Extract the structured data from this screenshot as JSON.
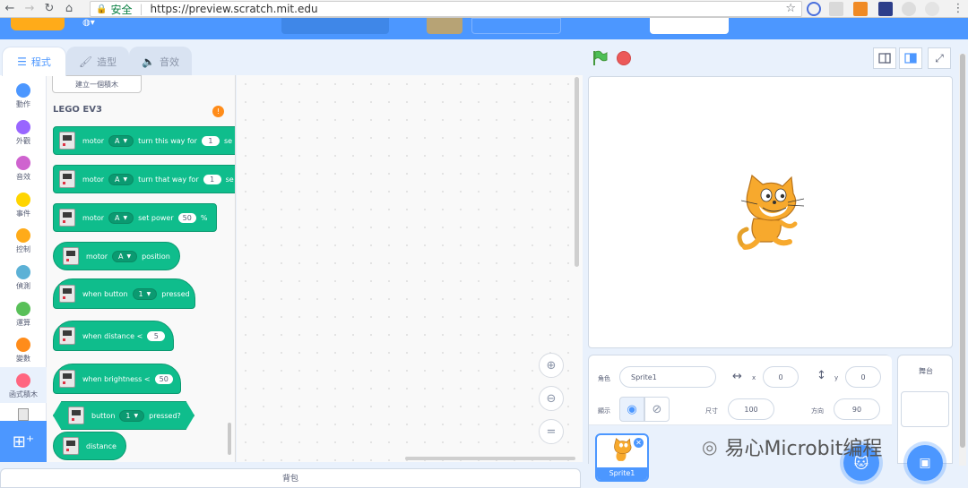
{
  "browser": {
    "security_label": "安全",
    "url": "https://preview.scratch.mit.edu"
  },
  "tabs": {
    "code": "程式",
    "costumes": "造型",
    "sounds": "音效"
  },
  "categories": [
    {
      "label": "動作",
      "color": "#4c97ff"
    },
    {
      "label": "外觀",
      "color": "#9966ff"
    },
    {
      "label": "音效",
      "color": "#cf63cf"
    },
    {
      "label": "事件",
      "color": "#ffd500"
    },
    {
      "label": "控制",
      "color": "#ffab19"
    },
    {
      "label": "偵測",
      "color": "#5cb1d6"
    },
    {
      "label": "運算",
      "color": "#59c059"
    },
    {
      "label": "變數",
      "color": "#ff8c1a"
    },
    {
      "label": "函式積木",
      "color": "#ff6680"
    }
  ],
  "palette": {
    "make_block": "建立一個積木",
    "section_title": "LEGO EV3",
    "blocks": {
      "b1": {
        "t1": "motor",
        "port": "A",
        "t2": "turn this way for",
        "val": "1",
        "t3": "se"
      },
      "b2": {
        "t1": "motor",
        "port": "A",
        "t2": "turn that way for",
        "val": "1",
        "t3": "se"
      },
      "b3": {
        "t1": "motor",
        "port": "A",
        "t2": "set power",
        "val": "50",
        "t3": "%"
      },
      "b4": {
        "t1": "motor",
        "port": "A",
        "t2": "position"
      },
      "b5": {
        "t1": "when button",
        "port": "1",
        "t2": "pressed"
      },
      "b6": {
        "t1": "when distance <",
        "val": "5"
      },
      "b7": {
        "t1": "when brightness <",
        "val": "50"
      },
      "b8": {
        "t1": "button",
        "port": "1",
        "t2": "pressed?"
      },
      "b9": {
        "t1": "distance"
      }
    }
  },
  "sprite_info": {
    "sprite_label": "角色",
    "sprite_name": "Sprite1",
    "x_label": "x",
    "x_value": "0",
    "y_label": "y",
    "y_value": "0",
    "show_label": "顯示",
    "size_label": "尺寸",
    "size_value": "100",
    "direction_label": "方向",
    "direction_value": "90"
  },
  "sprite_list": {
    "tile_name": "Sprite1"
  },
  "stage_pane": {
    "label": "舞台"
  },
  "backpack": {
    "label": "背包"
  },
  "watermark": {
    "text": "易心Microbit编程"
  }
}
